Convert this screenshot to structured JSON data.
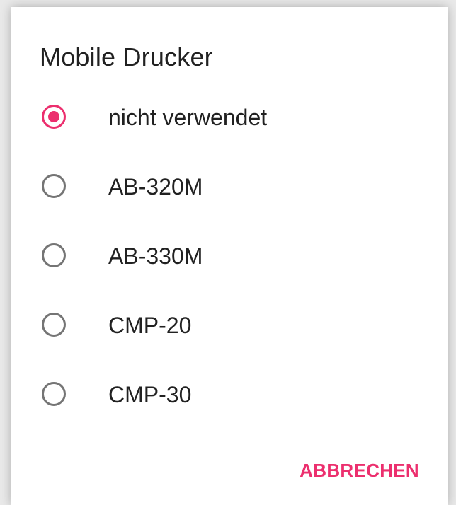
{
  "dialog": {
    "title": "Mobile Drucker",
    "options": [
      {
        "label": "nicht verwendet",
        "selected": true
      },
      {
        "label": "AB-320M",
        "selected": false
      },
      {
        "label": "AB-330M",
        "selected": false
      },
      {
        "label": "CMP-20",
        "selected": false
      },
      {
        "label": "CMP-30",
        "selected": false
      }
    ],
    "cancel_label": "ABBRECHEN"
  },
  "colors": {
    "accent": "#ec2f6e",
    "text": "#212121",
    "radio_unchecked": "#757575",
    "background": "#ffffff"
  }
}
